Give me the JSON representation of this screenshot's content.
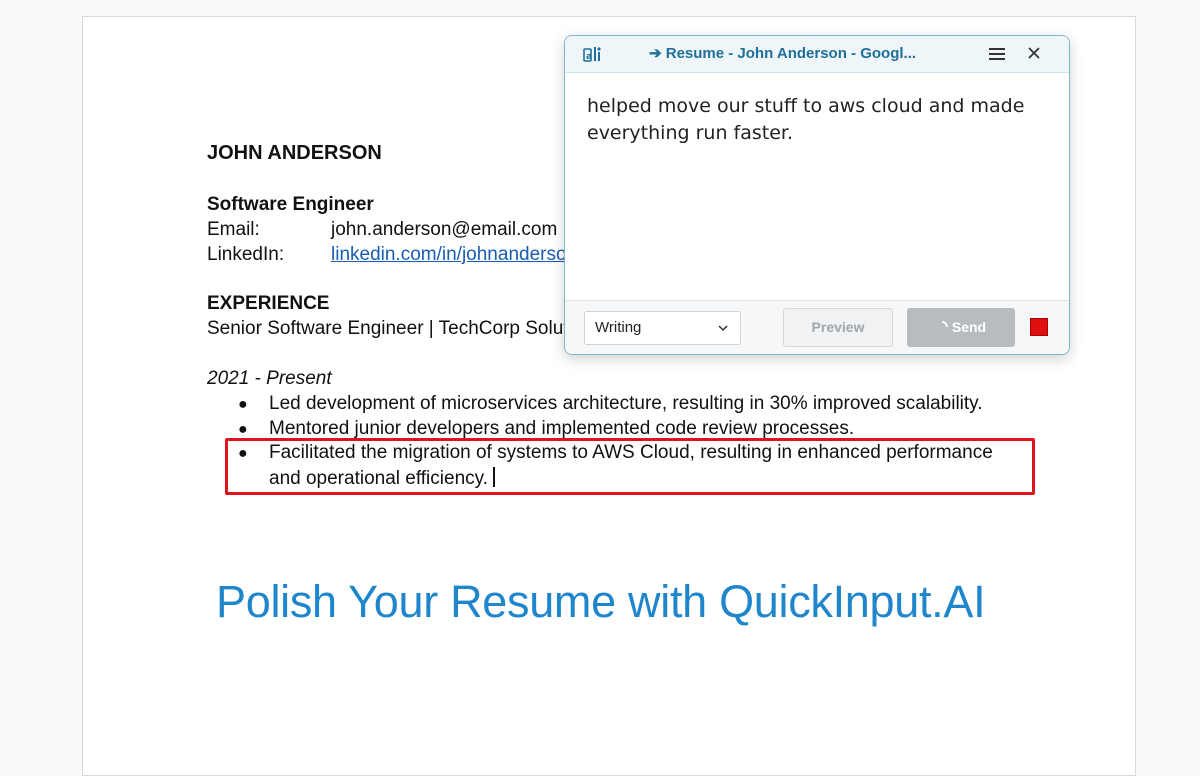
{
  "resume": {
    "name": "JOHN ANDERSON",
    "role": "Software Engineer",
    "email_label": "Email:",
    "email_value": "john.anderson@email.com",
    "linkedin_label": "LinkedIn:",
    "linkedin_value": "linkedin.com/in/johnanderso",
    "experience_heading": "EXPERIENCE",
    "job_title": "Senior Software Engineer | TechCorp Solut",
    "date_range": "2021 - Present",
    "bullet_symbol": "●",
    "bullets": [
      "Led development of microservices architecture, resulting in 30% improved scalability.",
      "Mentored junior developers and implemented code review processes.",
      "Facilitated the migration of systems to AWS Cloud, resulting in enhanced performance",
      "and operational efficiency."
    ]
  },
  "promo_text": "Polish Your Resume with QuickInput.AI",
  "popup": {
    "title": "➔ Resume - John Anderson - Googl...",
    "input_text": "helped move our stuff to aws cloud and made everything run faster.",
    "mode_selected": "Writing",
    "preview_label": "Preview",
    "send_label": "Send",
    "icons": {
      "app": "quickinput-icon",
      "menu": "hamburger-menu-icon",
      "close": "close-icon",
      "dropdown": "chevron-down-icon",
      "spinner": "loading-spinner-icon",
      "stop": "stop-icon"
    }
  },
  "colors": {
    "highlight_border": "#e0131c",
    "promo_blue": "#1f86cc",
    "link_blue": "#1a5db0",
    "stop_red": "#e01010"
  }
}
